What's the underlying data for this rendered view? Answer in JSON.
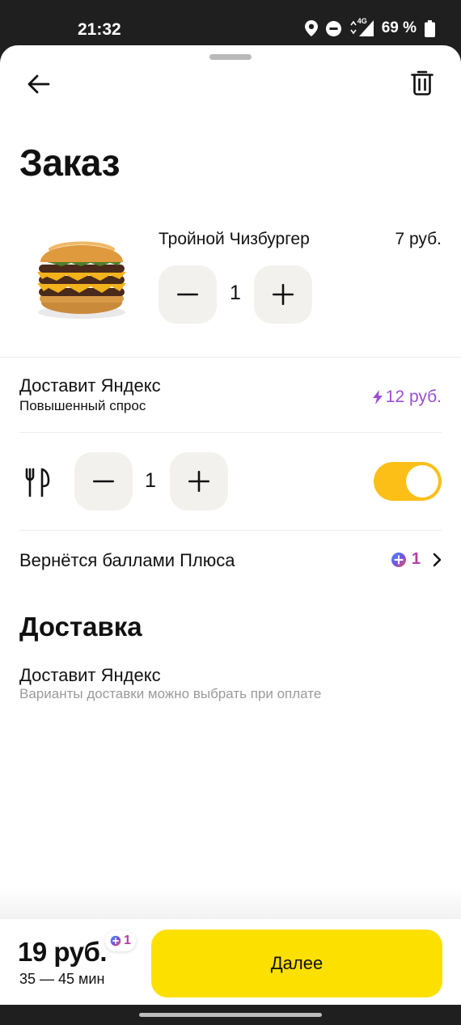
{
  "status_bar": {
    "time": "21:32",
    "network_label": "4G",
    "battery": "69 %",
    "icons": [
      "location-icon",
      "dnd-icon",
      "signal-icon",
      "battery-icon"
    ]
  },
  "header": {
    "back_icon": "arrow-left-icon",
    "trash_icon": "trash-icon",
    "title": "Заказ"
  },
  "order_item": {
    "name": "Тройной Чизбургер",
    "price": "7 руб.",
    "quantity": "1",
    "image": "burger-image"
  },
  "delivery_row": {
    "title": "Доставит Яндекс",
    "subtitle": "Повышенный спрос",
    "price": "12 руб.",
    "price_icon": "lightning-icon"
  },
  "cutlery": {
    "icon": "cutlery-icon",
    "quantity": "1",
    "toggle_on": true
  },
  "plus_cashback": {
    "label": "Вернётся баллами Плюса",
    "points": "1",
    "icon": "plus-points-icon"
  },
  "delivery_section": {
    "title": "Доставка",
    "provider": "Доставит Яндекс",
    "hint": "Варианты доставки можно выбрать при оплате"
  },
  "footer": {
    "total": "19 руб.",
    "points": "1",
    "eta": "35 — 45 мин",
    "next_label": "Далее"
  },
  "colors": {
    "accent_yellow": "#fce000",
    "toggle_yellow": "#fcbf17",
    "surge_purple": "#9b4fd1",
    "plus_magenta": "#b53ea3",
    "stepper_bg": "#f2f1ee"
  }
}
